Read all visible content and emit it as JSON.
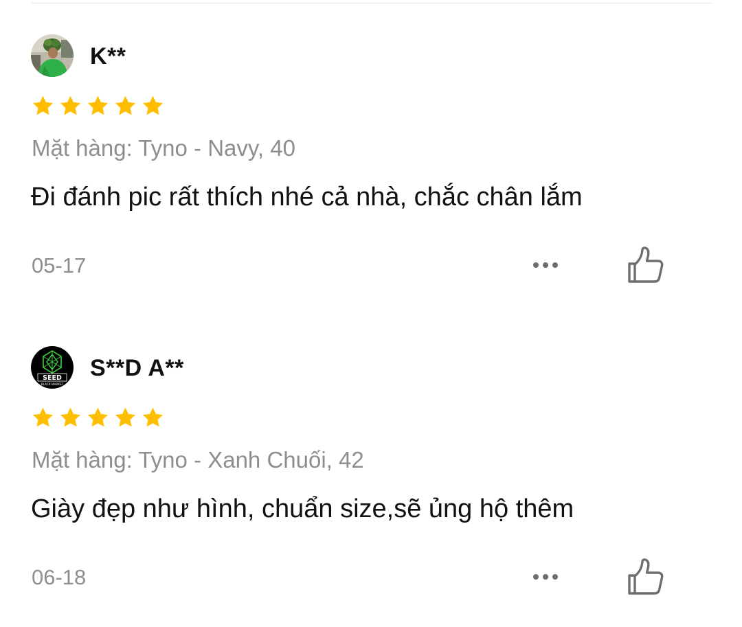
{
  "reviews": [
    {
      "username": "K**",
      "rating": 5,
      "variant": "Mặt hàng: Tyno - Navy, 40",
      "comment": "Đi đánh pic rất thích nhé cả nhà, chắc chân lắm",
      "date": "05-17",
      "avatar": "avatar-photo-green-shirt"
    },
    {
      "username": "S**D A**",
      "rating": 5,
      "variant": "Mặt hàng: Tyno - Xanh Chuối, 42",
      "comment": "Giày đẹp như hình, chuẩn size,sẽ ủng hộ thêm",
      "date": "06-18",
      "avatar": "avatar-seed-logo",
      "avatar_logo_text": "SEED",
      "avatar_logo_subtext": "BLACK MARKET"
    }
  ],
  "icons": {
    "star": "star-icon",
    "more": "more-icon",
    "like": "thumbs-up-icon"
  },
  "colors": {
    "star": "#ffbf00",
    "secondary_text": "#8e8e8e",
    "primary_text": "#111111",
    "icon_gray": "#6e6e6e",
    "seed_green": "#3fd13f"
  }
}
